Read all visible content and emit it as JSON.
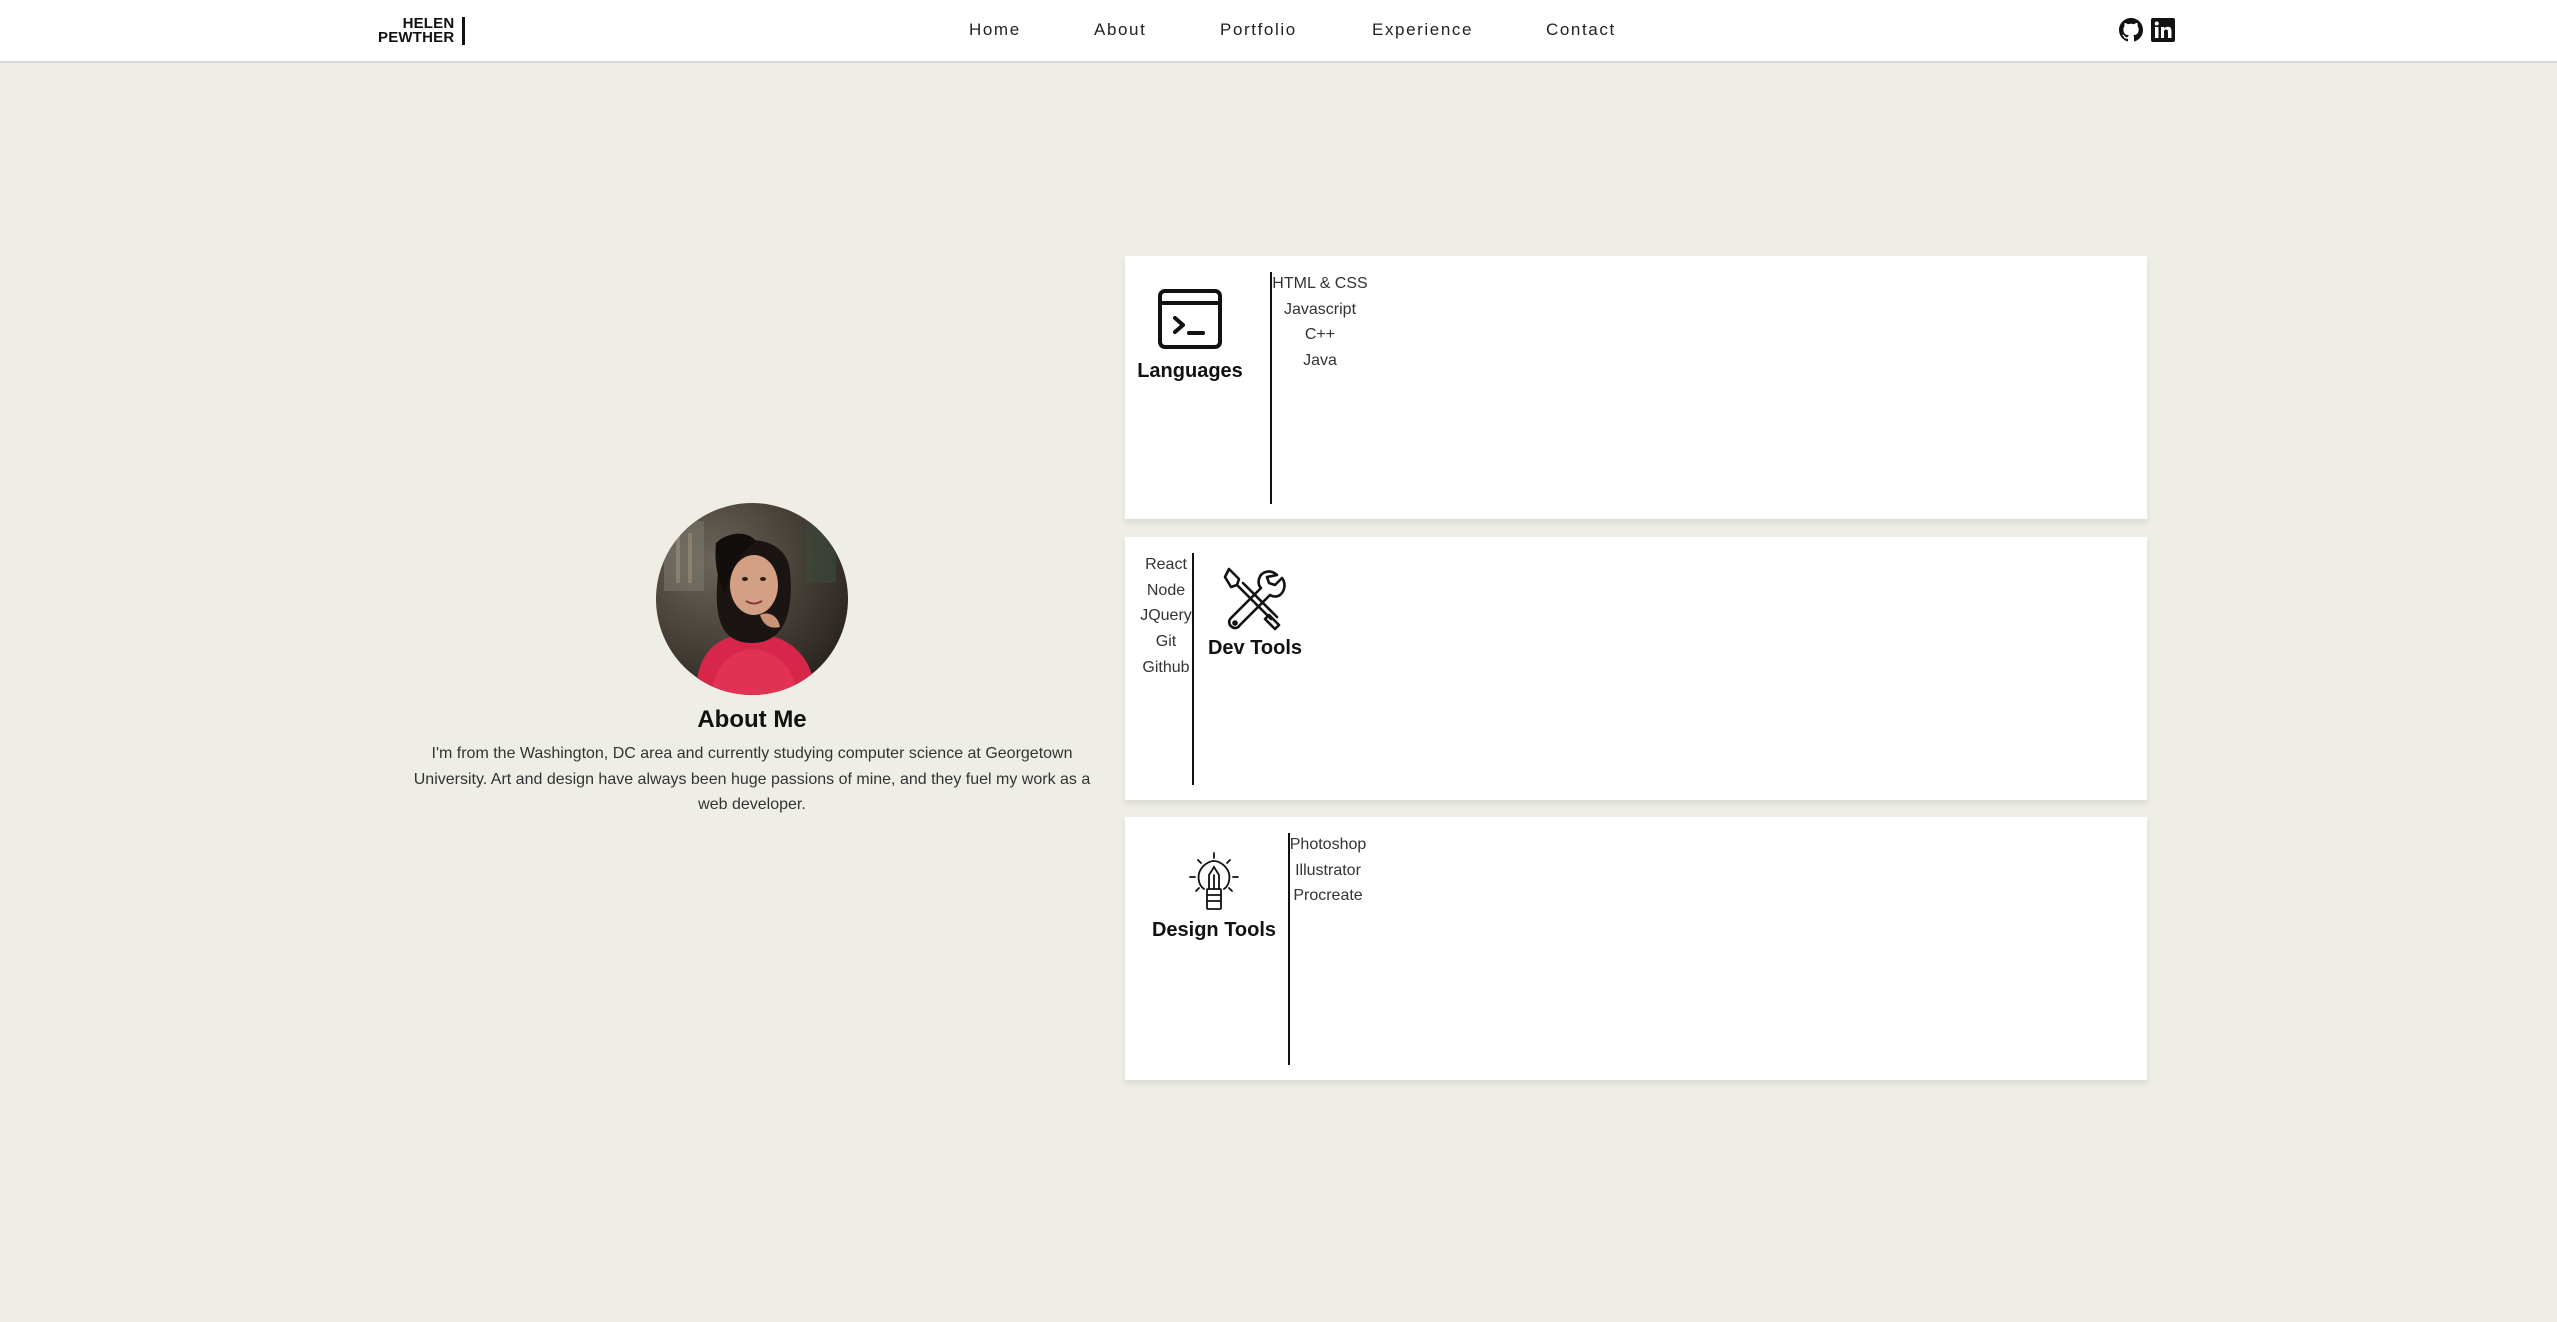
{
  "logo": {
    "line1": "HELEN",
    "line2": "PEWTHER"
  },
  "nav": {
    "home": "Home",
    "about": "About",
    "portfolio": "Portfolio",
    "experience": "Experience",
    "contact": "Contact"
  },
  "social": {
    "github_icon": "github-icon",
    "linkedin_icon": "linkedin-icon"
  },
  "about": {
    "title": "About Me",
    "text": "I'm from the Washington, DC area and currently studying computer science at Georgetown University. Art and design have always been huge passions of mine, and they fuel my work as a web developer."
  },
  "skills": {
    "languages": {
      "title": "Languages",
      "icon": "terminal-icon",
      "items": [
        "HTML & CSS",
        "Javascript",
        "C++",
        "Java"
      ]
    },
    "dev_tools": {
      "title": "Dev Tools",
      "icon": "tools-icon",
      "items": [
        "React",
        "Node",
        "JQuery",
        "Git",
        "Github"
      ]
    },
    "design_tools": {
      "title": "Design Tools",
      "icon": "lightbulb-pencil-icon",
      "items": [
        "Photoshop",
        "Illustrator",
        "Procreate"
      ]
    }
  },
  "colors": {
    "background": "#eeeee6",
    "card": "#ffffff",
    "text": "#222222"
  }
}
